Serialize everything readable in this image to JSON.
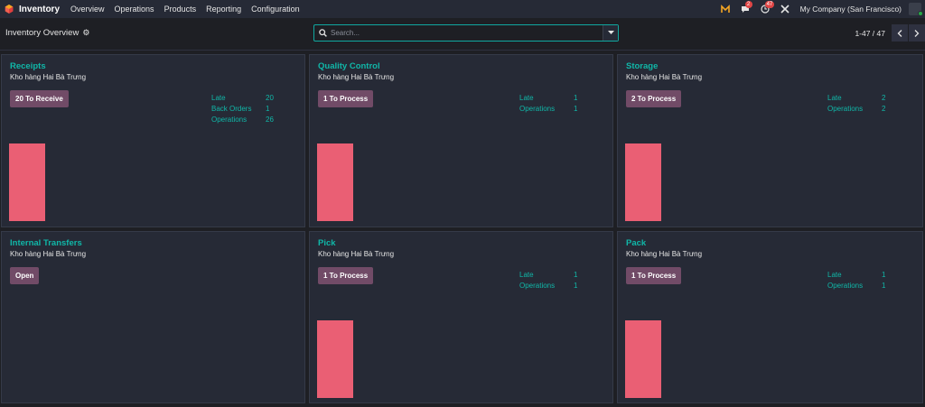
{
  "navbar": {
    "app_name": "Inventory",
    "menu": [
      "Overview",
      "Operations",
      "Products",
      "Reporting",
      "Configuration"
    ],
    "systray": {
      "discuss_count": "2",
      "activity_count": "47",
      "company": "My Company (San Francisco)"
    }
  },
  "control_panel": {
    "title": "Inventory Overview",
    "search_placeholder": "Search...",
    "pager": "1-47 / 47"
  },
  "colors": {
    "accent": "#10b7a8",
    "button": "#714b67",
    "bar": "#ea5f74"
  },
  "cards": [
    {
      "title": "Receipts",
      "warehouse": "Kho hàng Hai Bà Trưng",
      "button": "20 To Receive",
      "stats": [
        {
          "label": "Late",
          "value": "20"
        },
        {
          "label": "Back Orders",
          "value": "1"
        },
        {
          "label": "Operations",
          "value": "26"
        }
      ],
      "has_chart": true
    },
    {
      "title": "Quality Control",
      "warehouse": "Kho hàng Hai Bà Trưng",
      "button": "1 To Process",
      "stats": [
        {
          "label": "Late",
          "value": "1"
        },
        {
          "label": "Operations",
          "value": "1"
        }
      ],
      "has_chart": true
    },
    {
      "title": "Storage",
      "warehouse": "Kho hàng Hai Bà Trưng",
      "button": "2 To Process",
      "stats": [
        {
          "label": "Late",
          "value": "2"
        },
        {
          "label": "Operations",
          "value": "2"
        }
      ],
      "has_chart": true
    },
    {
      "title": "Internal Transfers",
      "warehouse": "Kho hàng Hai Bà Trưng",
      "button": "Open",
      "stats": [],
      "has_chart": false
    },
    {
      "title": "Pick",
      "warehouse": "Kho hàng Hai Bà Trưng",
      "button": "1 To Process",
      "stats": [
        {
          "label": "Late",
          "value": "1"
        },
        {
          "label": "Operations",
          "value": "1"
        }
      ],
      "has_chart": true
    },
    {
      "title": "Pack",
      "warehouse": "Kho hàng Hai Bà Trưng",
      "button": "1 To Process",
      "stats": [
        {
          "label": "Late",
          "value": "1"
        },
        {
          "label": "Operations",
          "value": "1"
        }
      ],
      "has_chart": true
    }
  ]
}
